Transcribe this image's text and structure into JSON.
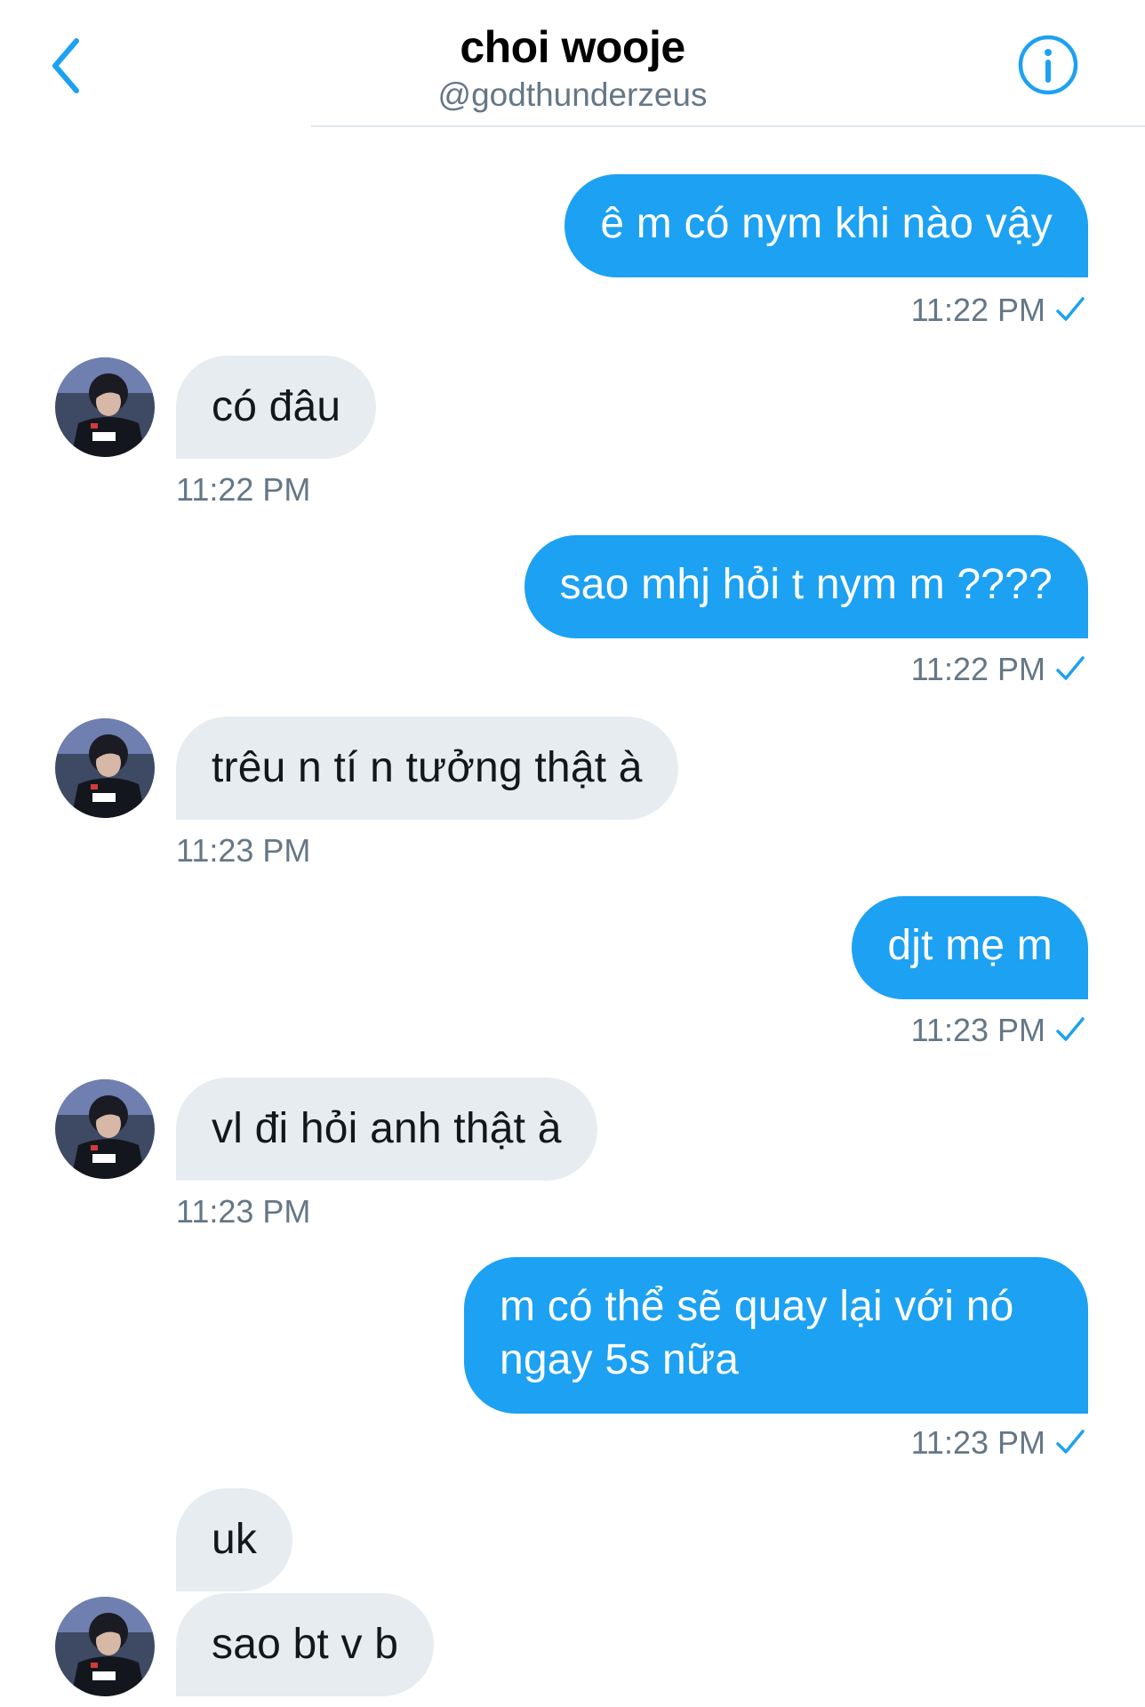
{
  "header": {
    "title": "choi wooje",
    "handle": "@godthunderzeus",
    "back_icon": "chevron-left-icon",
    "info_icon": "info-circle-icon"
  },
  "colors": {
    "accent": "#1da1f2",
    "incoming_bubble": "#e6ecf0",
    "meta_text": "#657786"
  },
  "messages": [
    {
      "direction": "outgoing",
      "text": "ê m có nym khi nào vậy",
      "time": "11:22 PM",
      "read": true
    },
    {
      "direction": "incoming",
      "text": "có đâu",
      "time": "11:22 PM"
    },
    {
      "direction": "outgoing",
      "text": "sao mhj hỏi t nym m ????",
      "time": "11:22 PM",
      "read": true
    },
    {
      "direction": "incoming",
      "text": "trêu n tí n tưởng thật à",
      "time": "11:23 PM"
    },
    {
      "direction": "outgoing",
      "text": "djt mẹ m",
      "time": "11:23 PM",
      "read": true
    },
    {
      "direction": "incoming",
      "text": "vl đi hỏi anh thật à",
      "time": "11:23 PM"
    },
    {
      "direction": "outgoing",
      "text": "m có thể sẽ quay lại với nó ngay 5s nữa",
      "time": "11:23 PM",
      "read": true
    },
    {
      "direction": "incoming",
      "text": "uk"
    },
    {
      "direction": "incoming",
      "text": "sao bt v b"
    }
  ]
}
